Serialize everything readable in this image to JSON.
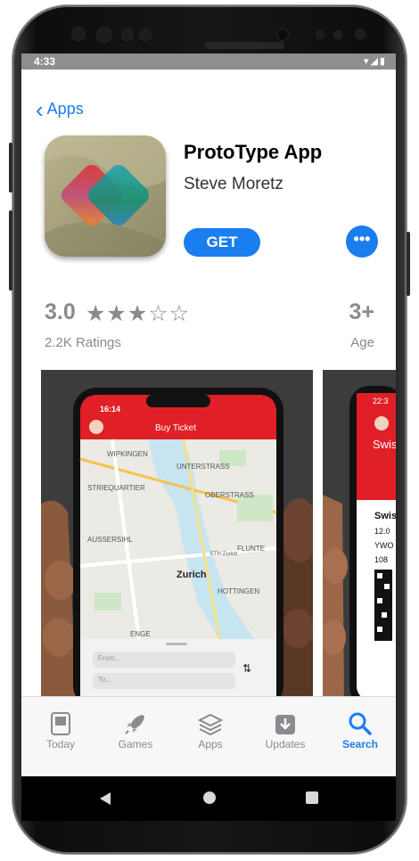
{
  "status": {
    "time": "4:33",
    "icons": "▾◢▮"
  },
  "nav": {
    "back_label": "Apps"
  },
  "app": {
    "title": "ProtoType App",
    "developer": "Steve Moretz",
    "get_label": "GET",
    "more_label": "•••"
  },
  "ratings": {
    "score": "3.0",
    "stars": "★★★☆☆",
    "count": "2.2K Ratings",
    "age": "3+",
    "age_label": "Age"
  },
  "screenshot1": {
    "time": "16:14",
    "header": "Buy Ticket",
    "map_labels": [
      "WIPKINGEN",
      "UNTERSTRASS",
      "STRIEQUARTIER",
      "OBERSTRASS",
      "AUSSERSIHL",
      "FLUNTE",
      "Zurich",
      "HOTTINGEN",
      "ENGE",
      "ETH Zurich"
    ],
    "from_placeholder": "From...",
    "to_placeholder": "To..."
  },
  "screenshot2": {
    "time": "22:3",
    "lines": [
      "Swis",
      "Swis",
      "12.0",
      "YWO",
      "108"
    ]
  },
  "tabs": [
    {
      "label": "Today",
      "icon": "today-icon",
      "active": false
    },
    {
      "label": "Games",
      "icon": "rocket-icon",
      "active": false
    },
    {
      "label": "Apps",
      "icon": "layers-icon",
      "active": false
    },
    {
      "label": "Updates",
      "icon": "download-icon",
      "active": false
    },
    {
      "label": "Search",
      "icon": "search-icon",
      "active": true
    }
  ],
  "colors": {
    "accent": "#1a7df0",
    "header_red": "#e01f26",
    "status_gray": "#8e8e8e"
  }
}
